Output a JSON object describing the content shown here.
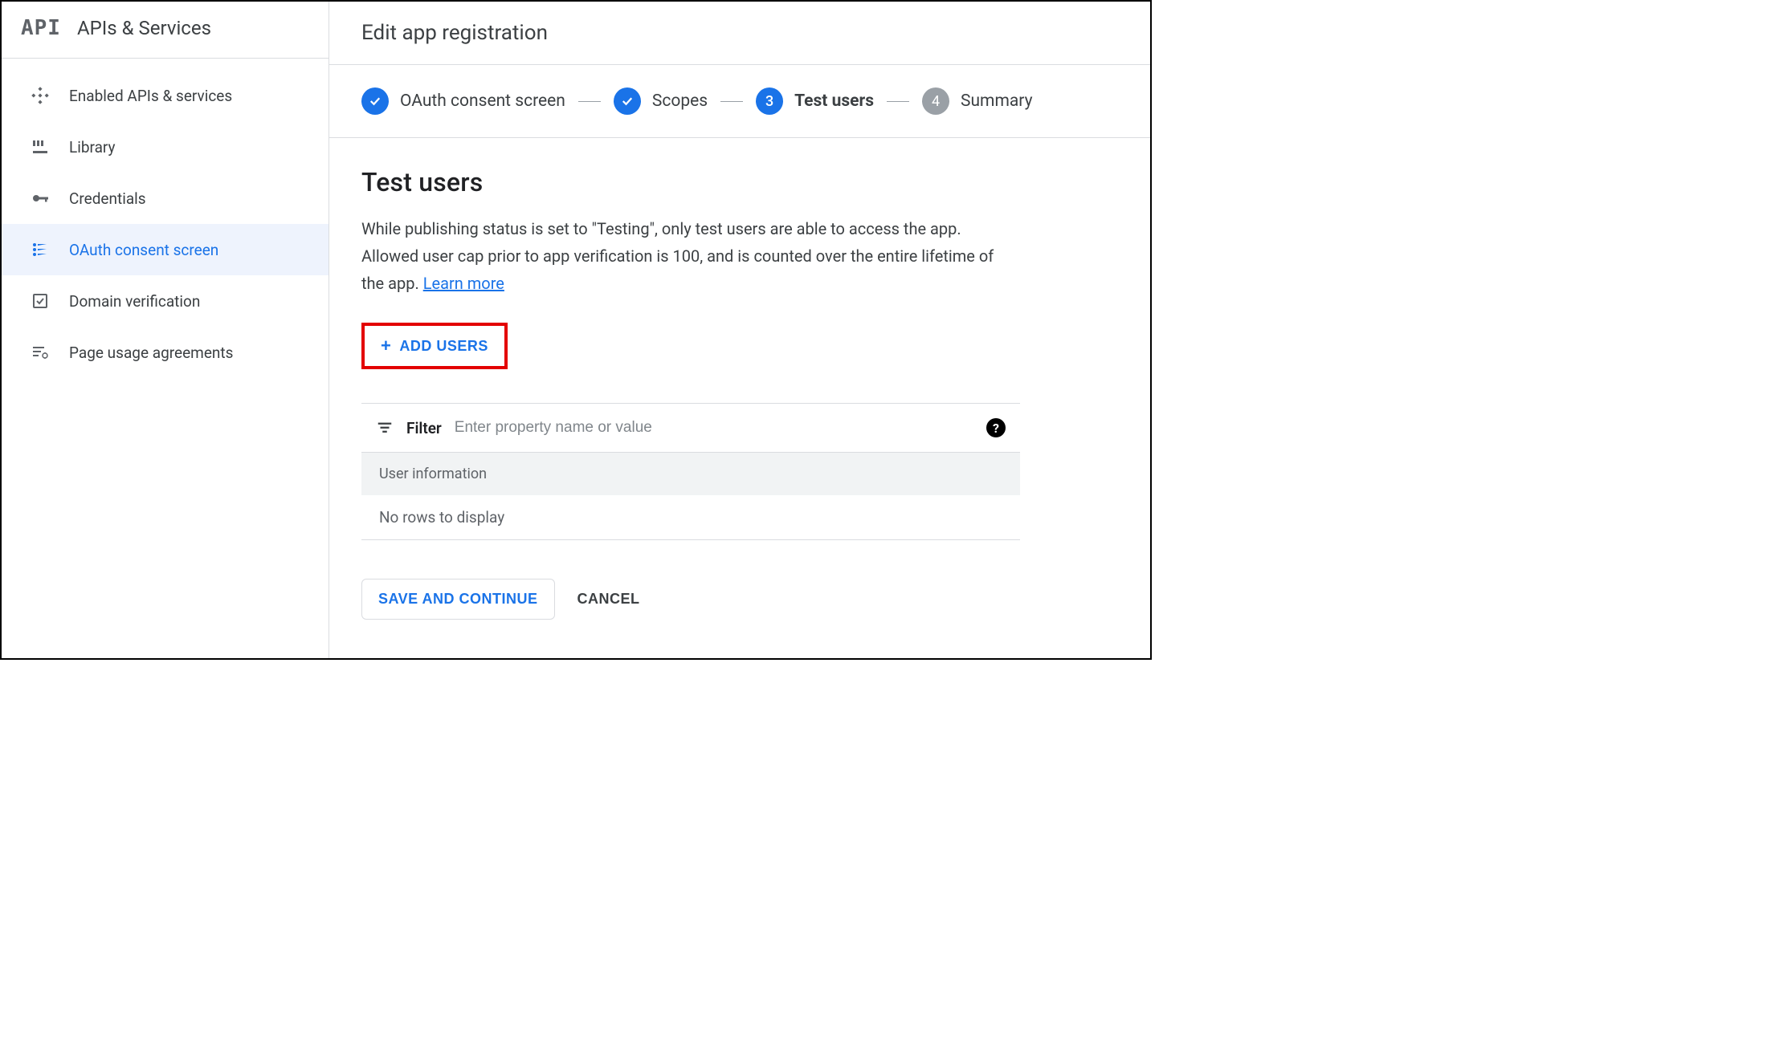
{
  "sidebar": {
    "logo_text": "API",
    "title": "APIs & Services",
    "items": [
      {
        "label": "Enabled APIs & services"
      },
      {
        "label": "Library"
      },
      {
        "label": "Credentials"
      },
      {
        "label": "OAuth consent screen"
      },
      {
        "label": "Domain verification"
      },
      {
        "label": "Page usage agreements"
      }
    ]
  },
  "header": {
    "title": "Edit app registration"
  },
  "stepper": {
    "steps": [
      {
        "label": "OAuth consent screen"
      },
      {
        "label": "Scopes"
      },
      {
        "label": "Test users",
        "num": "3"
      },
      {
        "label": "Summary",
        "num": "4"
      }
    ]
  },
  "section": {
    "title": "Test users",
    "desc_prefix": "While publishing status is set to \"Testing\", only test users are able to access the app. Allowed user cap prior to app verification is 100, and is counted over the entire lifetime of the app. ",
    "learn_more": "Learn more",
    "add_users": "ADD USERS"
  },
  "table": {
    "filter_label": "Filter",
    "filter_placeholder": "Enter property name or value",
    "header": "User information",
    "empty": "No rows to display"
  },
  "actions": {
    "save": "SAVE AND CONTINUE",
    "cancel": "CANCEL"
  }
}
